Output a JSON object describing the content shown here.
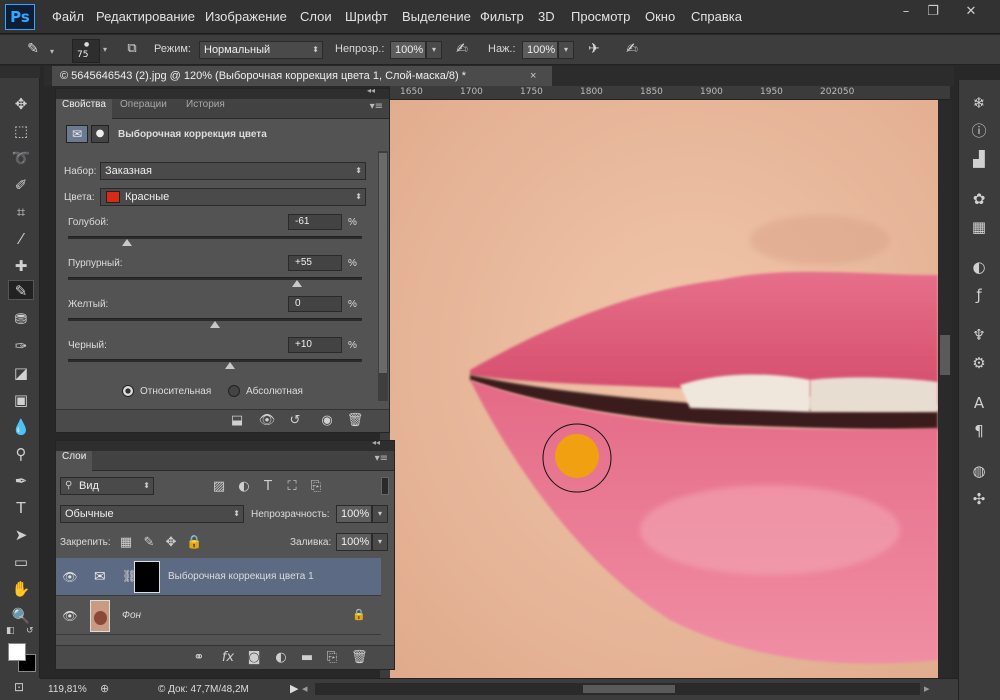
{
  "app": {
    "logo": "Ps"
  },
  "menu": [
    "Файл",
    "Редактирование",
    "Изображение",
    "Слои",
    "Шрифт",
    "Выделение",
    "Фильтр",
    "3D",
    "Просмотр",
    "Окно",
    "Справка"
  ],
  "window_controls": {
    "minimize": "–",
    "restore": "❐",
    "close": "✕"
  },
  "options": {
    "brush_size": "75",
    "mode_label": "Режим:",
    "mode_value": "Нормальный",
    "opacity_label": "Непрозр.:",
    "opacity_value": "100%",
    "flow_label": "Наж.:",
    "flow_value": "100%"
  },
  "document": {
    "tab_title": "© 5645646543 (2).jpg @ 120% (Выборочная коррекция цвета 1, Слой-маска/8) *",
    "close": "×"
  },
  "ruler": [
    "1650",
    "1700",
    "1750",
    "1800",
    "1850",
    "1900",
    "1950",
    "202050"
  ],
  "properties": {
    "tabs": [
      "Свойства",
      "Операции",
      "История"
    ],
    "title": "Выборочная коррекция цвета",
    "preset_label": "Набор:",
    "preset_value": "Заказная",
    "colors_label": "Цвета:",
    "colors_value": "Красные",
    "color_swatch": "#d92b13",
    "sliders": [
      {
        "label": "Голубой:",
        "value": "-61",
        "unit": "%",
        "level": 0.2
      },
      {
        "label": "Пурпурный:",
        "value": "+55",
        "unit": "%",
        "level": 0.78
      },
      {
        "label": "Желтый:",
        "value": "0",
        "unit": "%",
        "level": 0.5
      },
      {
        "label": "Черный:",
        "value": "+10",
        "unit": "%",
        "level": 0.55
      }
    ],
    "method_relative": "Относительная",
    "method_absolute": "Абсолютная"
  },
  "layers": {
    "tab": "Слои",
    "filter_value": "Вид",
    "blend_mode": "Обычные",
    "opacity_label": "Непрозрачность:",
    "opacity_value": "100%",
    "lock_label": "Закрепить:",
    "fill_label": "Заливка:",
    "fill_value": "100%",
    "items": [
      {
        "name": "Выборочная коррекция цвета 1"
      },
      {
        "name": "Фон"
      }
    ]
  },
  "status": {
    "zoom": "119,81%",
    "doc": "© Док: 47,7М/48,2М"
  },
  "colors": {
    "accent": "#31a8ff",
    "foreground": "#ffffff",
    "background": "#000000",
    "brush": "#f0a010"
  }
}
